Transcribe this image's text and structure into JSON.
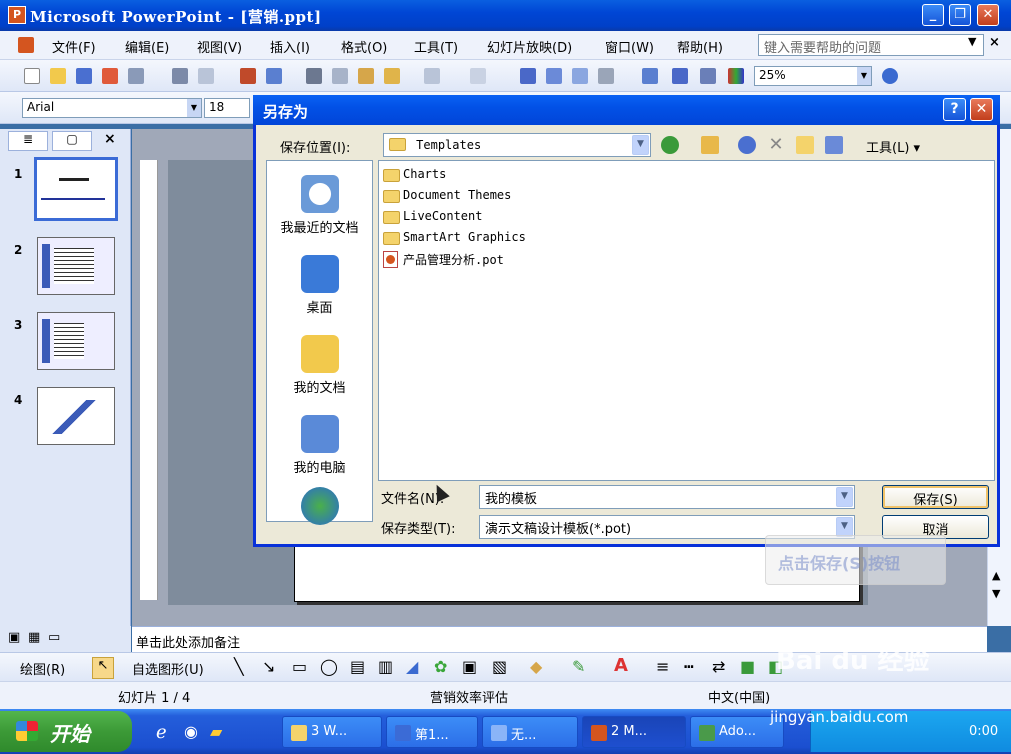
{
  "window": {
    "title": "Microsoft PowerPoint - [营销.ppt]",
    "icon": "powerpoint-icon"
  },
  "menubar": {
    "items": [
      "文件(F)",
      "编辑(E)",
      "视图(V)",
      "插入(I)",
      "格式(O)",
      "工具(T)",
      "幻灯片放映(D)",
      "窗口(W)",
      "帮助(H)"
    ],
    "help_placeholder": "键入需要帮助的问题"
  },
  "formatting": {
    "font": "Arial",
    "size": "18",
    "zoom": "25%"
  },
  "slides": {
    "numbers": [
      "1",
      "2",
      "3",
      "4"
    ]
  },
  "notes": {
    "placeholder": "单击此处添加备注"
  },
  "drawbar": {
    "draw_label": "绘图(R)",
    "autoshape_label": "自选图形(U)"
  },
  "status": {
    "slide": "幻灯片 1 / 4",
    "design": "营销效率评估",
    "language": "中文(中国)"
  },
  "dialog": {
    "title": "另存为",
    "save_in_label": "保存位置(I):",
    "save_in_value": "Templates",
    "tools_label": "工具(L)",
    "places": [
      "我最近的文档",
      "桌面",
      "我的文档",
      "我的电脑"
    ],
    "files": [
      {
        "name": "Charts",
        "type": "folder"
      },
      {
        "name": "Document Themes",
        "type": "folder"
      },
      {
        "name": "LiveContent",
        "type": "folder"
      },
      {
        "name": "SmartArt Graphics",
        "type": "folder"
      },
      {
        "name": "产品管理分析.pot",
        "type": "pot"
      }
    ],
    "filename_label": "文件名(N):",
    "filename_value": "我的模板",
    "filetype_label": "保存类型(T):",
    "filetype_value": "演示文稿设计模板(*.pot)",
    "save_button": "保存(S)",
    "cancel_button": "取消"
  },
  "hint": {
    "text": "点击保存(S)按钮"
  },
  "taskbar": {
    "start": "开始",
    "tasks": [
      "3 W...",
      "第1...",
      "无...",
      "2 M...",
      "Ado..."
    ],
    "clock": "0:00"
  },
  "watermark": {
    "brand": "Bai du 经验",
    "url": "jingyan.baidu.com"
  }
}
